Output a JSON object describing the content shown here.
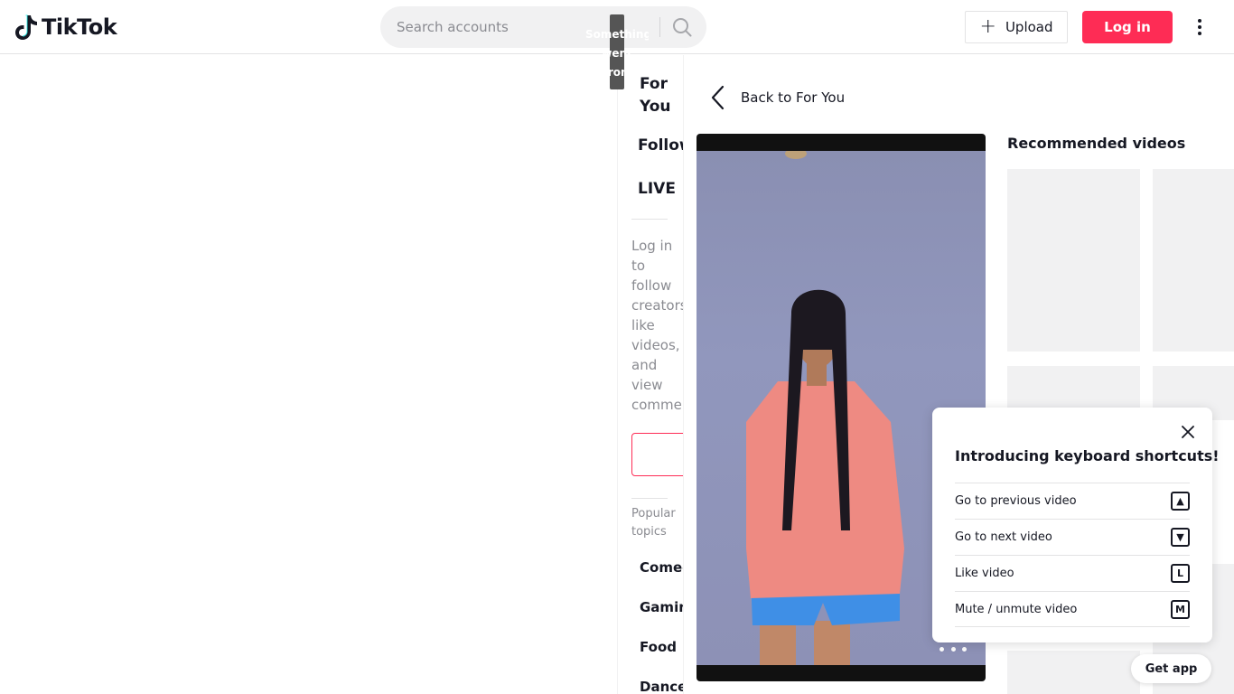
{
  "header": {
    "logo_text": "TikTok",
    "search_placeholder": "Search accounts",
    "upload_label": "Upload",
    "login_label": "Log in",
    "tooltip_text": "Something went wrong"
  },
  "sidenav": {
    "items": [
      {
        "label": "For You"
      },
      {
        "label": "Following"
      },
      {
        "label": "LIVE"
      }
    ],
    "login_prompt": "Log in to follow creators, like videos, and view comments.",
    "popular_topics_title": "Popular topics",
    "topics": [
      "Comedy",
      "Gaming",
      "Food",
      "Dance"
    ]
  },
  "main": {
    "back_label": "Back to For You",
    "recommended_title": "Recommended videos"
  },
  "shortcuts": {
    "title": "Introducing keyboard shortcuts!",
    "rows": [
      {
        "label": "Go to previous video",
        "key": "▲"
      },
      {
        "label": "Go to next video",
        "key": "▼"
      },
      {
        "label": "Like video",
        "key": "L"
      },
      {
        "label": "Mute / unmute video",
        "key": "M"
      }
    ]
  },
  "get_app_label": "Get app",
  "colors": {
    "brand": "#fe2c55",
    "text": "#161823",
    "muted": "#8a8b91"
  }
}
